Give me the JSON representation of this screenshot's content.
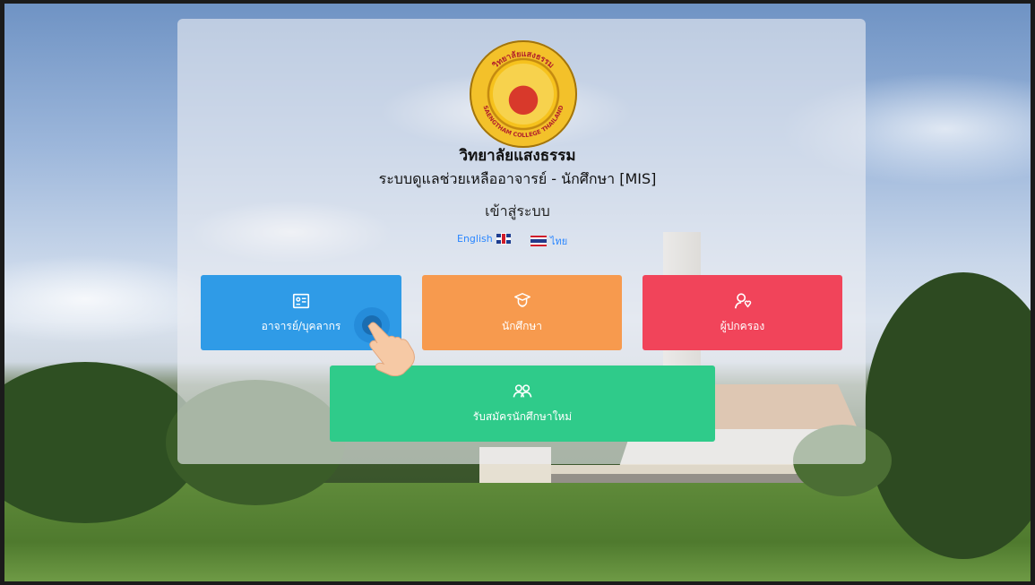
{
  "college": {
    "name": "วิทยาลัยแสงธรรม",
    "system": "ระบบดูแลช่วยเหลืออาจารย์ - นักศึกษา [MIS]",
    "login_label": "เข้าสู่ระบบ",
    "logo_text_top": "วิทยาลัยแสงธรรม",
    "logo_text_bottom": "SAENGTHAM COLLEGE THAILAND"
  },
  "languages": {
    "english": "English",
    "thai": "ไทย"
  },
  "buttons": {
    "teacher": {
      "label": "อาจารย์/บุคลากร",
      "icon": "id-card-icon",
      "color": "#2f9be7"
    },
    "student": {
      "label": "นักศึกษา",
      "icon": "graduate-icon",
      "color": "#f79a4e"
    },
    "parent": {
      "label": "ผู้ปกครอง",
      "icon": "parent-icon",
      "color": "#f1445a"
    },
    "apply": {
      "label": "รับสมัครนักศึกษาใหม่",
      "icon": "users-icon",
      "color": "#2fcb8a"
    }
  }
}
